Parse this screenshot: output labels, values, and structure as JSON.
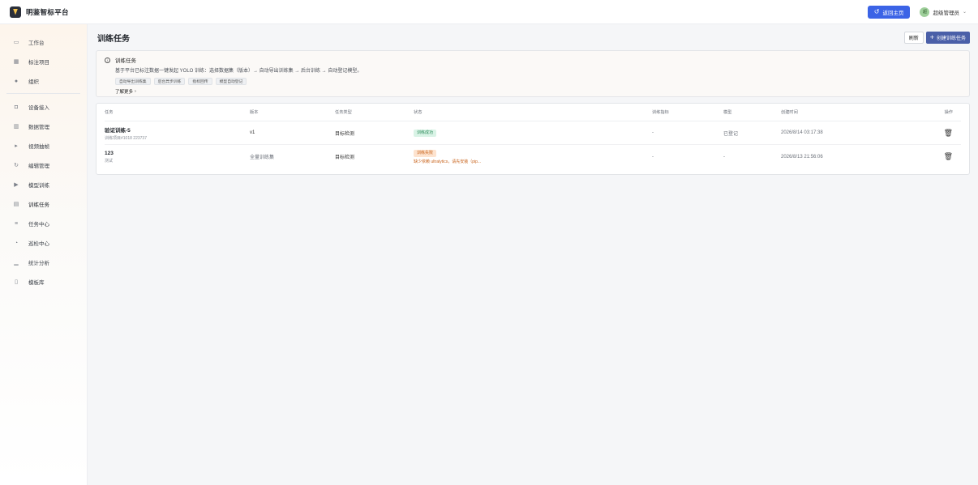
{
  "brand": {
    "name": "明鉴智标平台",
    "icon": "shield-logo"
  },
  "header": {
    "home_button": "返回主页",
    "user_avatar_text": "超",
    "user_name": "超级管理员"
  },
  "sidebar": {
    "items": [
      {
        "label": "工作台",
        "icon": "monitor-icon"
      },
      {
        "label": "标注项目",
        "icon": "grid-icon"
      },
      {
        "label": "组织",
        "icon": "user-icon"
      },
      {
        "label": "设备接入",
        "icon": "device-icon"
      },
      {
        "label": "数据管理",
        "icon": "database-icon"
      },
      {
        "label": "视频抽帧",
        "icon": "play-small-icon"
      },
      {
        "label": "编辑管理",
        "icon": "refresh-icon"
      },
      {
        "label": "模型训练",
        "icon": "play-icon"
      },
      {
        "label": "训练任务",
        "icon": "document-icon"
      },
      {
        "label": "任务中心",
        "icon": "list-icon"
      },
      {
        "label": "巡检中心",
        "icon": "inspect-icon"
      },
      {
        "label": "统计分析",
        "icon": "bar-chart-icon"
      },
      {
        "label": "模板库",
        "icon": "book-icon"
      }
    ]
  },
  "page": {
    "title": "训练任务",
    "refresh_label": "刷新",
    "create_label": "创建训练任务"
  },
  "info": {
    "title": "训练任务",
    "description": "基于平台已标注数据一键发起 YOLO 训练：选择数据集（版本）→ 自动导出训练集 → 后台训练 → 自动登记模型。",
    "tags": [
      "自动导出训练集",
      "后台异步训练",
      "指标回传",
      "模型自动登记"
    ],
    "more_link": "了解更多"
  },
  "table": {
    "columns": [
      "任务",
      "版本",
      "任务类型",
      "状态",
      "训练指标",
      "模型",
      "创建时间",
      "操作"
    ],
    "rows": [
      {
        "name": "验证训练-5",
        "sub": "训练项目#1018 223737",
        "version": "v1",
        "type": "目标检测",
        "status": "训练成功",
        "status_kind": "success",
        "metrics": "-",
        "model": "已登记",
        "created": "2026/8/14 03:17:38"
      },
      {
        "name": "123",
        "sub": "测试",
        "version": "全量训练集",
        "type": "目标检测",
        "status": "训练失败",
        "status_kind": "fail",
        "fail_message": "缺少依赖 ultralytics，请先安装（pip...",
        "metrics": "-",
        "model": "-",
        "created": "2026/8/13 21:56:06"
      }
    ]
  },
  "colors": {
    "primary": "#3b63e6",
    "create_button": "#4a5fa8",
    "success": "#2c8a5a",
    "fail": "#c8621a"
  }
}
